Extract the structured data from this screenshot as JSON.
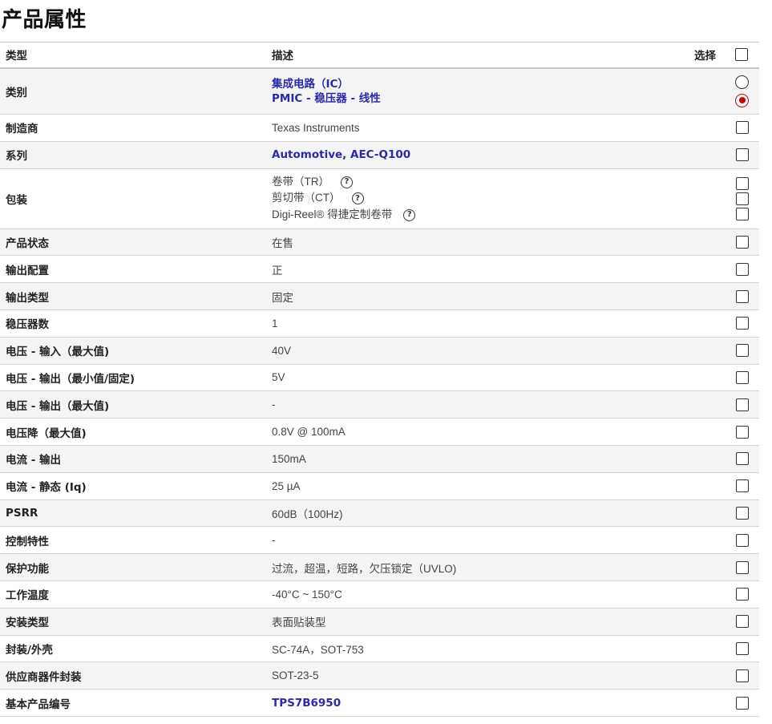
{
  "page_title": "产品属性",
  "header": {
    "type_label": "类型",
    "desc_label": "描述",
    "select_label": "选择"
  },
  "rows": [
    {
      "type": "类别",
      "desc": [
        "集成电路（IC）",
        "PMIC - 稳压器 - 线性"
      ],
      "kind": "radio",
      "selected_index": 1
    },
    {
      "type": "制造商",
      "desc": "Texas Instruments"
    },
    {
      "type": "系列",
      "desc": "Automotive, AEC-Q100",
      "link": true
    },
    {
      "type": "包装",
      "desc": [
        "卷带（TR）",
        "剪切带（CT）",
        "Digi-Reel® 得捷定制卷带"
      ],
      "kind": "multi"
    },
    {
      "type": "产品状态",
      "desc": "在售"
    },
    {
      "type": "输出配置",
      "desc": "正"
    },
    {
      "type": "输出类型",
      "desc": "固定"
    },
    {
      "type": "稳压器数",
      "desc": "1"
    },
    {
      "type": "电压 - 输入（最大值)",
      "desc": "40V"
    },
    {
      "type": "电压 - 输出（最小值/固定)",
      "desc": "5V"
    },
    {
      "type": "电压 - 输出（最大值)",
      "desc": "-"
    },
    {
      "type": "电压降（最大值)",
      "desc": "0.8V @ 100mA"
    },
    {
      "type": "电流 - 输出",
      "desc": "150mA"
    },
    {
      "type": "电流 - 静态 (Iq)",
      "desc": "25 µA"
    },
    {
      "type": "PSRR",
      "desc": "60dB（100Hz)"
    },
    {
      "type": "控制特性",
      "desc": "-"
    },
    {
      "type": "保护功能",
      "desc": "过流，超温，短路，欠压锁定（UVLO)"
    },
    {
      "type": "工作温度",
      "desc": "-40°C ~ 150°C"
    },
    {
      "type": "安装类型",
      "desc": "表面贴装型"
    },
    {
      "type": "封装/外壳",
      "desc": "SC-74A，SOT-753"
    },
    {
      "type": "供应商器件封装",
      "desc": "SOT-23-5"
    },
    {
      "type": "基本产品编号",
      "desc": "TPS7B6950",
      "link": true
    }
  ],
  "icons": {
    "help": "question-circle-icon"
  },
  "colors": {
    "link": "#2a2aa8",
    "radio_selected": "#cc0000",
    "row_alt": "#f4f4f4"
  }
}
